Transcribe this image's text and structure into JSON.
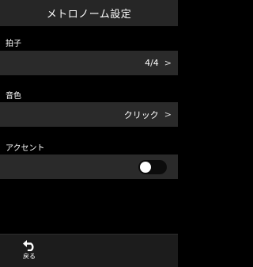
{
  "header": {
    "title": "メトロノーム設定"
  },
  "settings": [
    {
      "label": "拍子",
      "value": "4/4"
    },
    {
      "label": "音色",
      "value": "クリック"
    },
    {
      "label": "アクセント",
      "toggle_on": false
    }
  ],
  "chevron": ">",
  "bottom_bar": {
    "back_label": "戻る",
    "back_icon": "back-arrow-icon"
  }
}
